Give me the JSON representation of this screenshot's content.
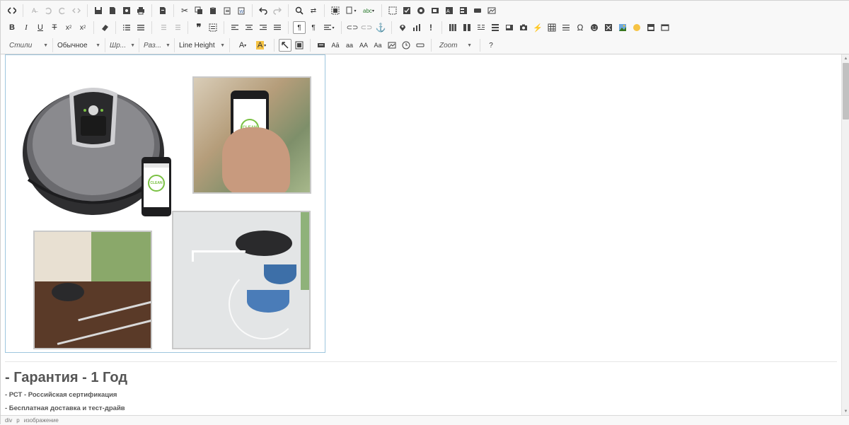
{
  "toolbar": {
    "row3": {
      "styles": "Стили",
      "format": "Обычное",
      "font": "Шр...",
      "size": "Раз...",
      "line_height": "Line Height",
      "zoom": "Zoom",
      "help": "?"
    }
  },
  "content": {
    "heading": "- Гарантия - 1 Год",
    "lines": [
      "- РСТ - Российская сертификация",
      "- Бесплатная доставка и тест-драйв"
    ],
    "phone_small_label": "CLEAN",
    "phone_large_label": "CLEAN"
  },
  "statusbar": {
    "path": [
      "div",
      "p",
      "изображение"
    ]
  },
  "colors": {
    "accent_green": "#7ac143",
    "toolbar_bg": "#f8f8f8",
    "image_border": "#9ec6de",
    "text": "#555555"
  }
}
